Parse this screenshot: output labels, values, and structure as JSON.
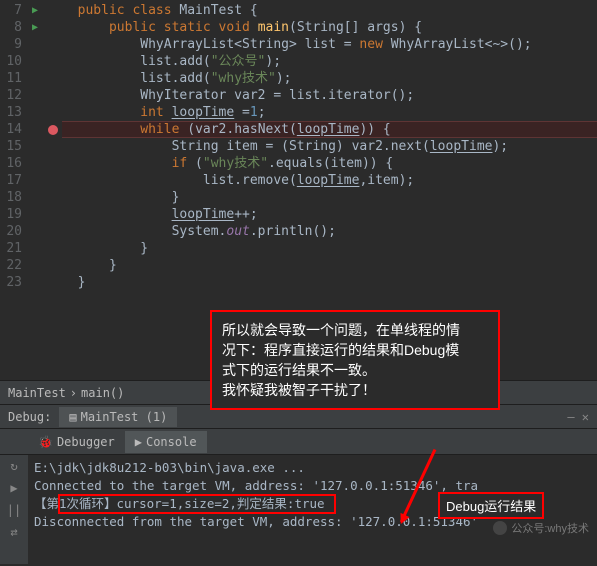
{
  "lines": [
    {
      "n": "7",
      "run": true,
      "html": "  <span class='k'>public class</span> <span class='cls'>MainTest</span> {"
    },
    {
      "n": "8",
      "run": true,
      "html": "      <span class='k'>public static void</span> <span class='mth'>main</span>(String[] args) {"
    },
    {
      "n": "9",
      "html": "          WhyArrayList&lt;String&gt; list = <span class='k'>new</span> WhyArrayList<span class='id'>&lt;~&gt;</span>();"
    },
    {
      "n": "10",
      "html": "          list.add(<span class='str'>\"公众号\"</span>);"
    },
    {
      "n": "11",
      "html": "          list.add(<span class='str'>\"why技术\"</span>);"
    },
    {
      "n": "12",
      "html": "          WhyIterator var2 = list.iterator();"
    },
    {
      "n": "13",
      "html": "          <span class='k'>int</span> <span class='und'>loopTime</span> =<span class='num'>1</span>;"
    },
    {
      "n": "14",
      "bp": true,
      "hl": true,
      "html": "          <span class='k'>while</span> (var2.hasNext(<span class='und'>loopTime</span>)) {"
    },
    {
      "n": "15",
      "html": "              String item = (String) var2.next(<span class='und'>loopTime</span>);"
    },
    {
      "n": "16",
      "html": "              <span class='k'>if</span> (<span class='str'>\"why技术\"</span>.equals(item)) {"
    },
    {
      "n": "17",
      "html": "                  list.remove(<span class='und'>loopTime</span>,item);"
    },
    {
      "n": "18",
      "html": "              }"
    },
    {
      "n": "19",
      "html": "              <span class='und'>loopTime</span>++;"
    },
    {
      "n": "20",
      "html": "              System.<span class='stat'>out</span>.println();"
    },
    {
      "n": "21",
      "html": "          }"
    },
    {
      "n": "22",
      "html": "      }"
    },
    {
      "n": "23",
      "html": "  }"
    }
  ],
  "crumb": {
    "a": "MainTest",
    "b": "main()"
  },
  "debug": {
    "label": "Debug:",
    "tab": "MainTest (1)",
    "tabs": {
      "debugger": "Debugger",
      "console": "Console"
    }
  },
  "console": {
    "l1": "E:\\jdk\\jdk8u212-b03\\bin\\java.exe ...",
    "l2a": "Connected to the target VM, address: '",
    "l2b": "127.0.0.1:51346', tra",
    "l3": "【第1次循环】cursor=1,size=2,判定结果:true",
    "l4a": "Disconnected from the target VM, address: '",
    "l4b": "127.0.0.1:51346'"
  },
  "annot": {
    "t1": "所以就会导致一个问题，在单线程的情",
    "t2": "况下：程序直接运行的结果和Debug模",
    "t3": "式下的运行结果不一致。",
    "t4": "我怀疑我被智子干扰了！"
  },
  "debugres": "Debug运行结果",
  "water": "公众号:why技术"
}
